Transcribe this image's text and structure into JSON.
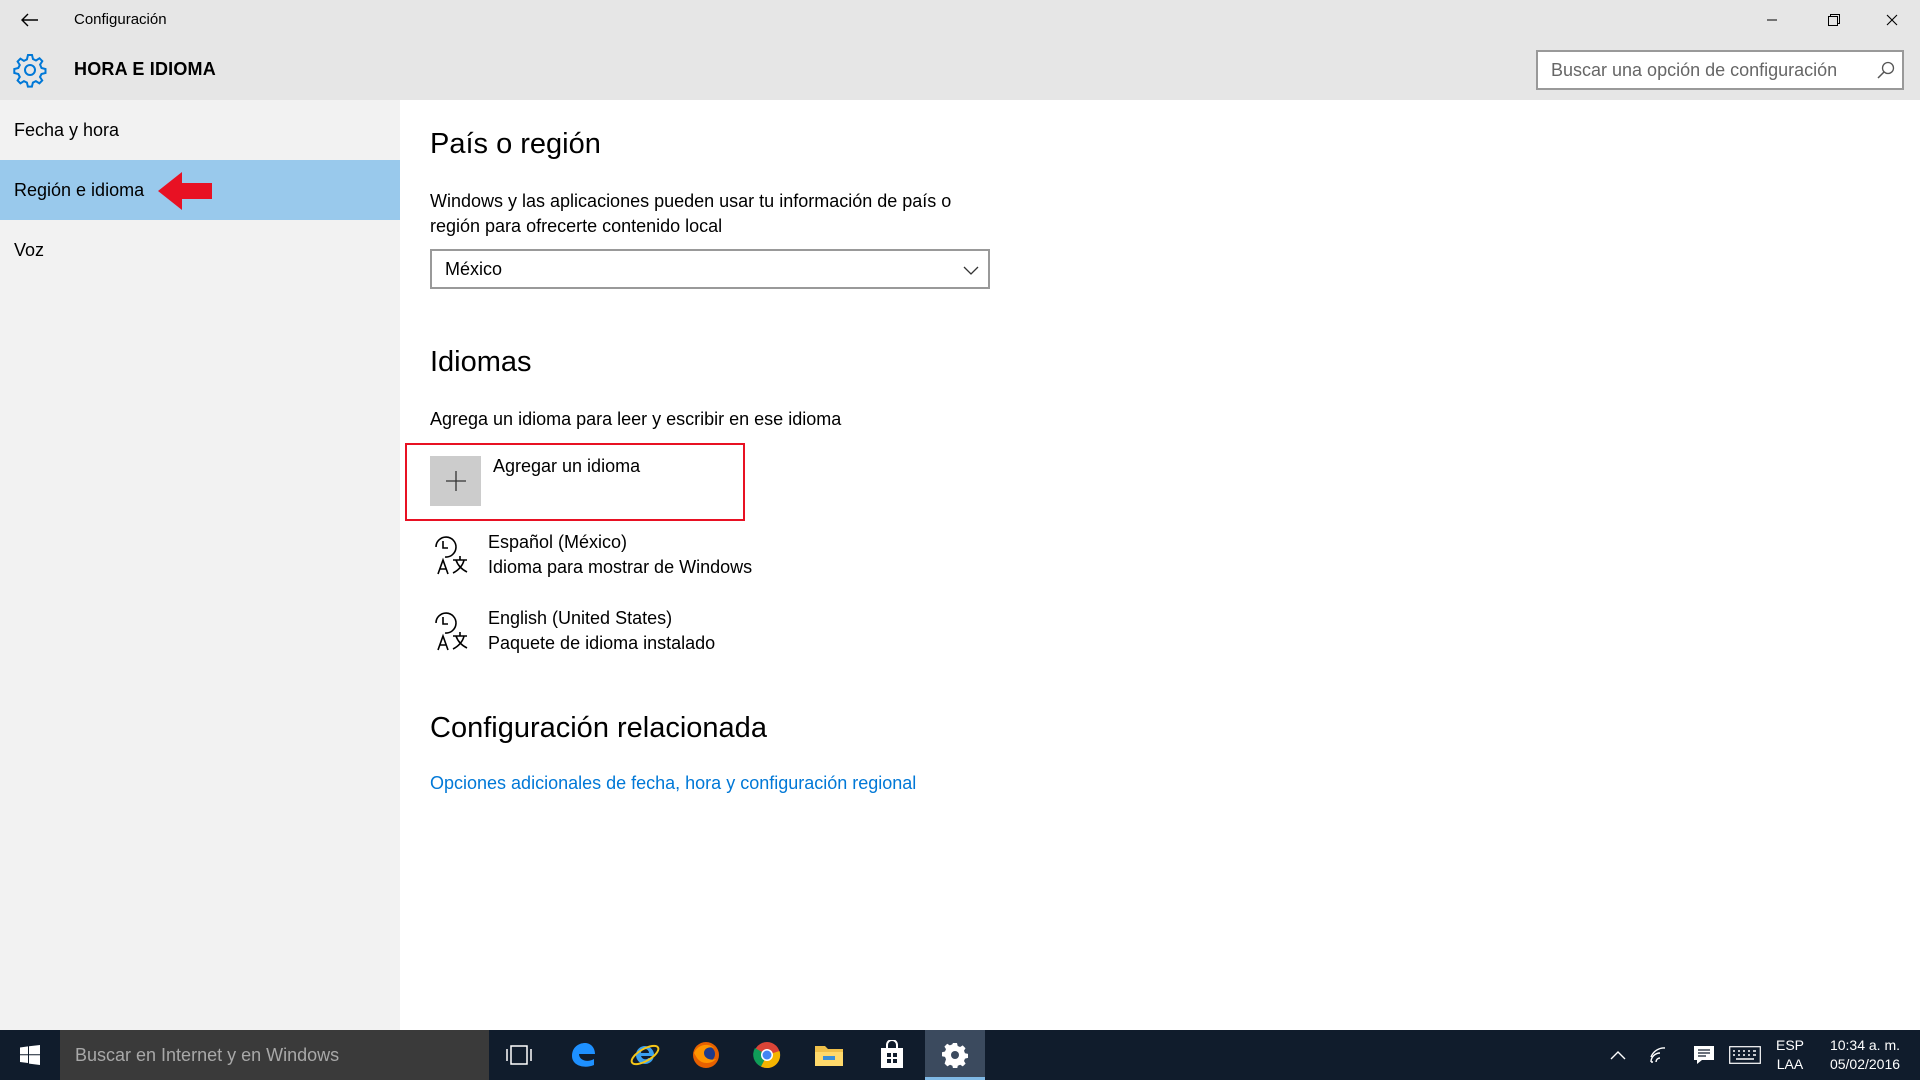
{
  "window": {
    "title": "Configuración",
    "minimize_icon": "minimize-icon",
    "maximize_icon": "restore-icon",
    "close_icon": "close-icon"
  },
  "header": {
    "title": "HORA E IDIOMA",
    "icon": "gear-icon",
    "search": {
      "placeholder": "Buscar una opción de configuración",
      "value": ""
    }
  },
  "sidebar": {
    "items": [
      {
        "label": "Fecha y hora",
        "selected": false
      },
      {
        "label": "Región e idioma",
        "selected": true
      },
      {
        "label": "Voz",
        "selected": false
      }
    ]
  },
  "main": {
    "country": {
      "heading": "País o región",
      "description_line1": "Windows y las aplicaciones pueden usar tu información de país o",
      "description_line2": "región para ofrecerte contenido local",
      "selected": "México"
    },
    "languages": {
      "heading": "Idiomas",
      "description": "Agrega un idioma para leer y escribir en ese idioma",
      "add_label": "Agregar un idioma",
      "items": [
        {
          "name": "Español (México)",
          "detail": "Idioma para mostrar de Windows"
        },
        {
          "name": "English (United States)",
          "detail": "Paquete de idioma instalado"
        }
      ]
    },
    "related": {
      "heading": "Configuración relacionada",
      "link": "Opciones adicionales de fecha, hora y configuración regional"
    }
  },
  "taskbar": {
    "search_text": "Buscar en Internet y en Windows",
    "apps": [
      "task-view-icon",
      "edge-icon",
      "internet-explorer-icon",
      "firefox-icon",
      "chrome-icon",
      "file-explorer-icon",
      "store-icon",
      "settings-icon"
    ],
    "language_line1": "ESP",
    "language_line2": "LAA",
    "time": "10:34 a. m.",
    "date": "05/02/2016"
  },
  "colors": {
    "accent": "#0078d7",
    "selected_nav": "#99c9ec",
    "annotation_red": "#e81123",
    "taskbar": "#101c2c"
  }
}
